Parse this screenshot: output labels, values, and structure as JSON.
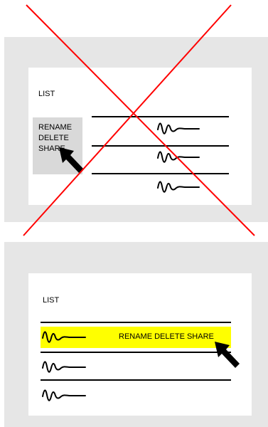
{
  "top_panel": {
    "list_label": "LIST",
    "menu_items": [
      "RENAME",
      "DELETE",
      "SHARE"
    ]
  },
  "bottom_panel": {
    "list_label": "LIST",
    "inline_actions": "RENAME DELETE SHARE"
  },
  "icons": {
    "cross": "red-x-cross-icon",
    "pointer": "black-arrow-pointer-icon",
    "squiggle": "damped-wave-squiggle-icon"
  },
  "colors": {
    "panel_bg": "#e6e6e6",
    "card_bg": "#ffffff",
    "menu_bg": "#d9d9d9",
    "highlight": "#ffff00",
    "cross": "#ff0000",
    "ink": "#000000"
  }
}
